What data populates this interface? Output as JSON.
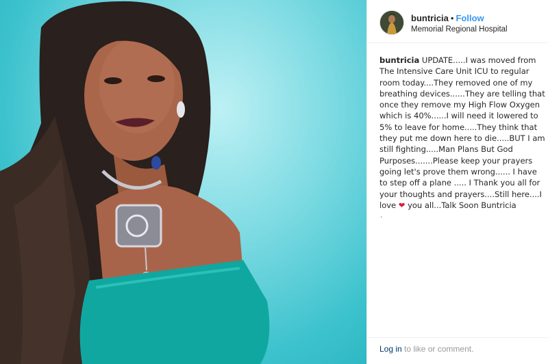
{
  "post": {
    "username": "buntricia",
    "separator": "•",
    "follow_label": "Follow",
    "location": "Memorial Regional Hospital",
    "caption_user": "buntricia",
    "caption_text_1": "UPDATE.....I was moved from The Intensive Care Unit ICU to regular room today....They removed one of my breathing devices......They are telling that once they remove my High Flow Oxygen which is 40%......I will need it lowered to 5% to leave for home.....They think that they put me down here to die.....BUT I am still fighting.....Man Plans But God Purposes.......Please keep your prayers going let's prove them wrong...... I have to step off a plane ..... I Thank you all for your thoughts and prayers....Still here....I love",
    "heart_glyph": "❤",
    "caption_text_2": "you all...Talk Soon Buntricia",
    "caption_tail": "˛"
  },
  "footer": {
    "login_label": "Log in",
    "footer_rest": "to like or comment."
  },
  "colors": {
    "photo_background": "#3cc2cd",
    "follow_link": "#3897f0",
    "heart": "#d8203a",
    "login_link": "#003569",
    "muted_text": "#999999"
  }
}
